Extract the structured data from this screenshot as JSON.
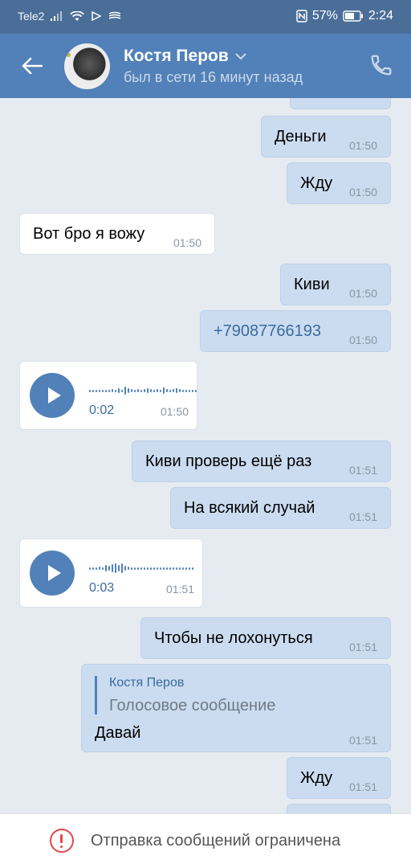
{
  "status_bar": {
    "carrier": "Tele2",
    "battery": "57%",
    "time": "2:24"
  },
  "header": {
    "contact_name": "Костя Перов",
    "last_seen": "был в сети 16 минут назад"
  },
  "messages": [
    {
      "dir": "out",
      "text": "Деньги",
      "time": "01:50"
    },
    {
      "dir": "out",
      "text": "Жду",
      "time": "01:50"
    },
    {
      "dir": "in",
      "text": "Вот бро я вожу",
      "time": "01:50"
    },
    {
      "dir": "out",
      "text": "Киви",
      "time": "01:50"
    },
    {
      "dir": "out",
      "text": "+79087766193",
      "time": "01:50"
    },
    {
      "dir": "in",
      "type": "voice",
      "duration": "0:02",
      "time": "01:50"
    },
    {
      "dir": "out",
      "text": "Киви проверь ещё раз",
      "time": "01:51"
    },
    {
      "dir": "out",
      "text": "На всякий случай",
      "time": "01:51"
    },
    {
      "dir": "in",
      "type": "voice",
      "duration": "0:03",
      "time": "01:51"
    },
    {
      "dir": "out",
      "text": "Чтобы не лохонуться",
      "time": "01:51"
    },
    {
      "dir": "out",
      "type": "reply",
      "reply_name": "Костя Перов",
      "reply_text": "Голосовое сообщение",
      "text": "Давай",
      "time": "01:51"
    },
    {
      "dir": "out",
      "text": "Жду",
      "time": "01:51"
    }
  ],
  "bottom_bar": {
    "notice": "Отправка сообщений ограничена"
  },
  "colors": {
    "header_bg": "#5181b8",
    "status_bg": "#4a6e98",
    "chat_bg": "#e6ebf1",
    "outgoing_bubble": "#cbdcf0",
    "incoming_bubble": "#ffffff",
    "accent": "#5181b8",
    "warning": "#e0464b"
  },
  "icons": {
    "back": "arrow-left-icon",
    "call": "phone-icon",
    "dropdown": "chevron-down-icon",
    "play": "play-icon",
    "notice": "exclamation-circle-icon"
  }
}
